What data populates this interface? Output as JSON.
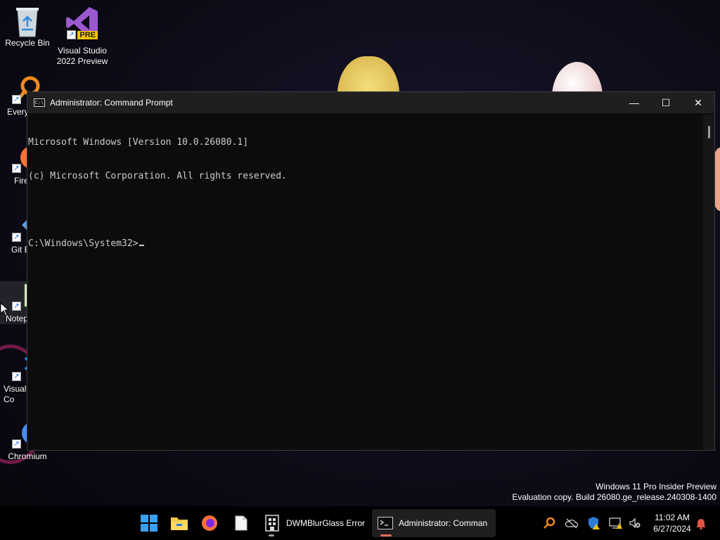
{
  "desktop": {
    "icons": [
      {
        "label": "Recycle Bin"
      },
      {
        "label": "Visual Studio 2022 Preview"
      },
      {
        "label": "Every"
      },
      {
        "label": "Fire"
      },
      {
        "label": "Git E"
      },
      {
        "label": "Notep"
      },
      {
        "label": "Visual\nCo"
      },
      {
        "label": "Chromium"
      }
    ],
    "vs_badge": "PRE"
  },
  "window": {
    "title": "Administrator: Command Prompt",
    "controls": {
      "minimize": "—",
      "maximize": "☐",
      "close": "✕"
    },
    "console_lines": [
      "Microsoft Windows [Version 10.0.26080.1]",
      "(c) Microsoft Corporation. All rights reserved.",
      "",
      "C:\\Windows\\System32>"
    ]
  },
  "watermark": {
    "line1": "Windows 11 Pro Insider Preview",
    "line2": "Evaluation copy. Build 26080.ge_release.240308-1400"
  },
  "taskbar": {
    "apps": [
      {
        "name": "start",
        "icon": "windows-logo"
      },
      {
        "name": "file-explorer",
        "icon": "folder-icon"
      },
      {
        "name": "firefox",
        "icon": "firefox-icon"
      },
      {
        "name": "notepad-file",
        "icon": "file-icon"
      },
      {
        "name": "dwmblurglass",
        "icon": "dwm-icon",
        "label": "DWMBlurGlass Error"
      },
      {
        "name": "cmd",
        "icon": "terminal-icon",
        "label": "Administrator: Comman"
      }
    ],
    "accent": "#e06c56",
    "clock": {
      "time": "11:02 AM",
      "date": "6/27/2024"
    }
  }
}
